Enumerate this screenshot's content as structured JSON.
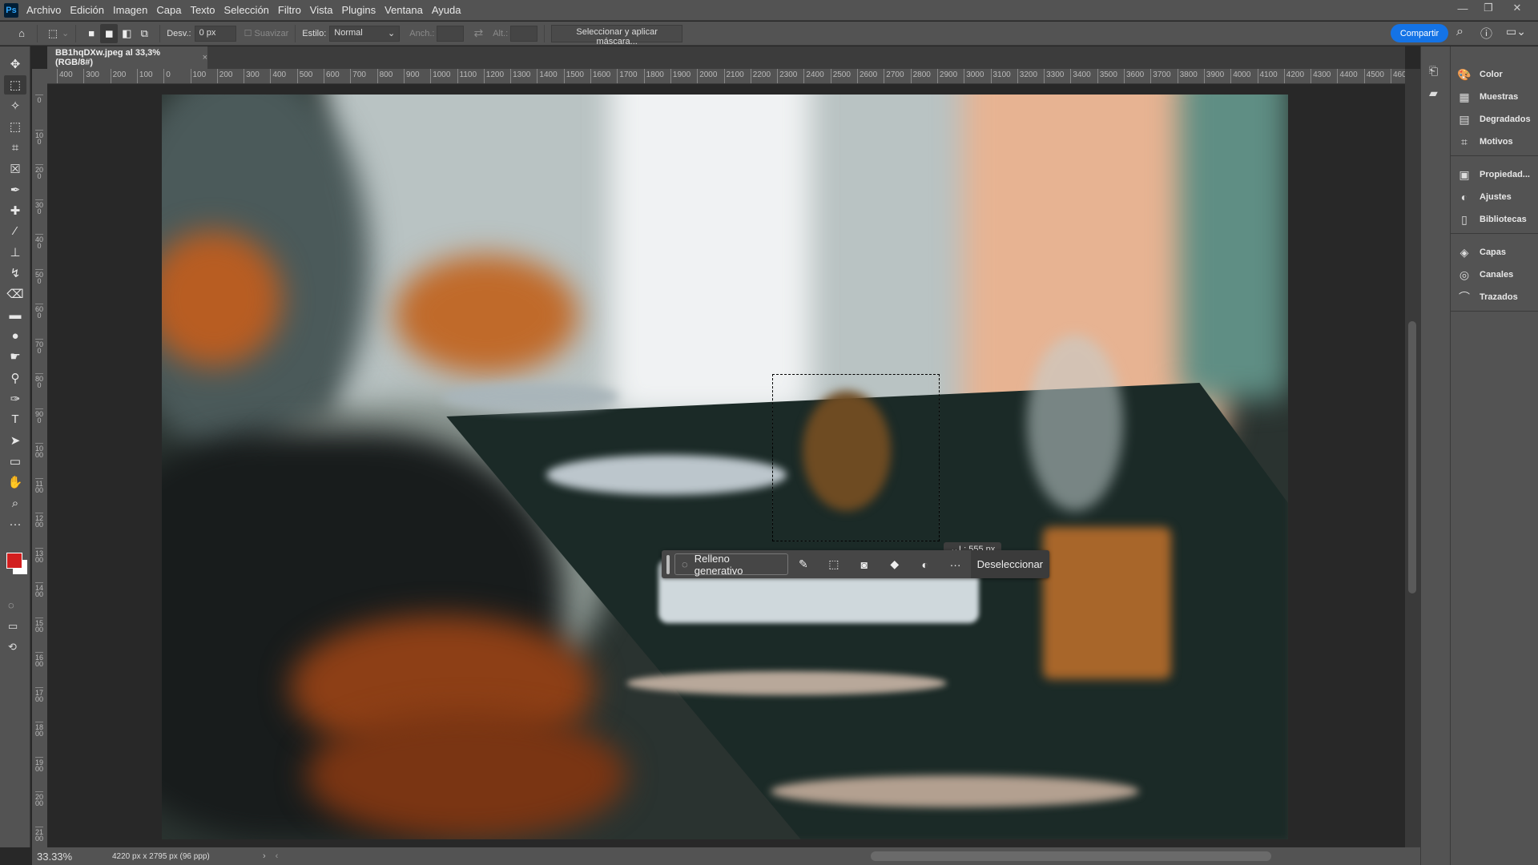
{
  "app": {
    "logo": "Ps"
  },
  "menu": [
    "Archivo",
    "Edición",
    "Imagen",
    "Capa",
    "Texto",
    "Selección",
    "Filtro",
    "Vista",
    "Plugins",
    "Ventana",
    "Ayuda"
  ],
  "window_controls": [
    "minimize-icon",
    "restore-icon",
    "close-icon"
  ],
  "options": {
    "feather_label": "Desv.:",
    "feather_value": "0 px",
    "antialias_label": "Suavizar",
    "style_label": "Estilo:",
    "style_value": "Normal",
    "width_label": "Anch.:",
    "height_label": "Alt.:",
    "mask_button": "Seleccionar y aplicar máscara...",
    "share_button": "Compartir"
  },
  "document": {
    "tab_title": "BB1hqDXw.jpeg al 33,3% (RGB/8#)",
    "close": "×"
  },
  "ruler": {
    "h_labels": [
      "400",
      "300",
      "200",
      "100",
      "0",
      "100",
      "200",
      "300",
      "400",
      "500",
      "600",
      "700",
      "800",
      "900",
      "1000",
      "1100",
      "1200",
      "1300",
      "1400",
      "1500",
      "1600",
      "1700",
      "1800",
      "1900",
      "2000",
      "2100",
      "2200",
      "2300",
      "2400",
      "2500",
      "2600",
      "2700",
      "2800",
      "2900",
      "3000",
      "3100",
      "3200",
      "3300",
      "3400",
      "3500",
      "3600",
      "3700",
      "3800",
      "3900",
      "4000",
      "4100",
      "4200",
      "4300",
      "4400",
      "4500",
      "460"
    ],
    "v_labels": [
      "0",
      "100",
      "200",
      "300",
      "400",
      "500",
      "600",
      "700",
      "800",
      "900",
      "1000",
      "1100",
      "1200",
      "1300",
      "1400",
      "1500",
      "1600",
      "1700",
      "1800",
      "1900",
      "2000",
      "2100"
    ]
  },
  "tools": [
    "move",
    "rectangular-marquee",
    "object-selection",
    "frame-select",
    "crop",
    "frame",
    "eyedropper",
    "healing-brush",
    "brush",
    "clone-stamp",
    "history-brush",
    "eraser",
    "gradient",
    "blur",
    "smudge",
    "dodge",
    "pen",
    "type",
    "path-selection",
    "rectangle",
    "hand",
    "zoom",
    "more"
  ],
  "colors": {
    "foreground": "#d21f1f",
    "background": "#ffffff",
    "accent": "#1473e6"
  },
  "status": {
    "zoom": "33.33%",
    "doc_info": "4220 px x 2795 px (96 ppp)"
  },
  "selection_tooltip": "↔L: 555 px",
  "context_bar": {
    "generative_fill": "Relleno generativo",
    "deselect": "Deseleccionar"
  },
  "panels": {
    "groups": [
      [
        "Color",
        "Muestras",
        "Degradados",
        "Motivos"
      ],
      [
        "Propiedad...",
        "Ajustes",
        "Bibliotecas"
      ],
      [
        "Capas",
        "Canales",
        "Trazados"
      ]
    ]
  }
}
